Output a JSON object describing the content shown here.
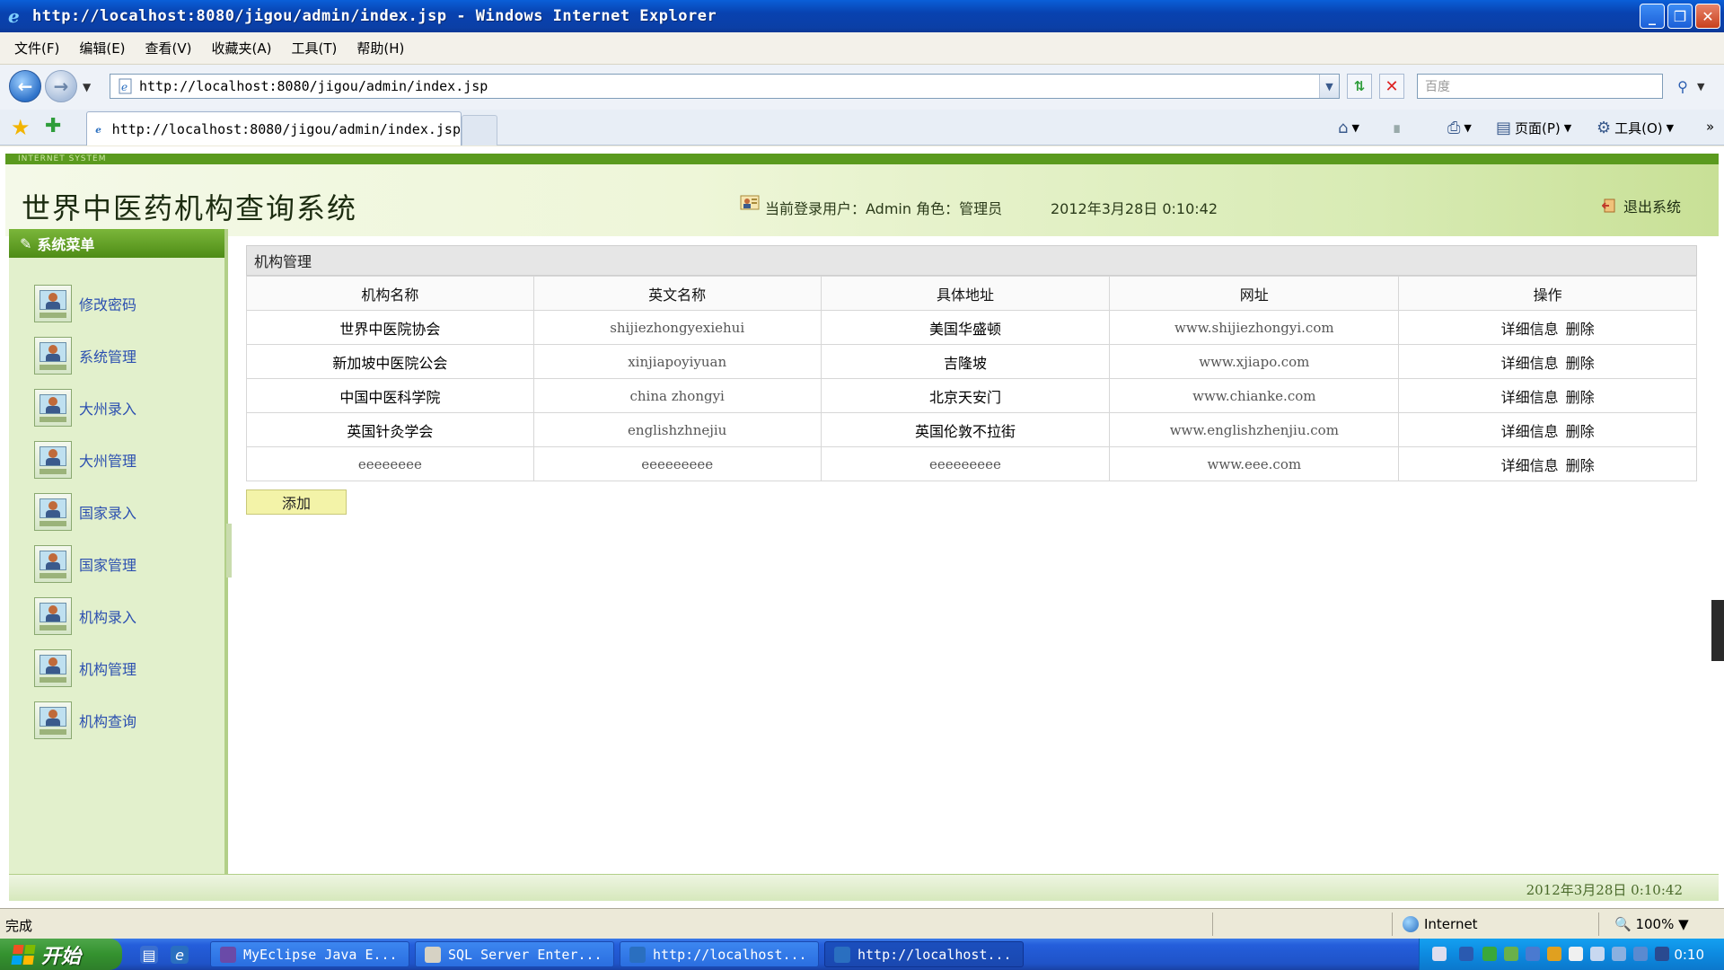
{
  "window": {
    "title": "http://localhost:8080/jigou/admin/index.jsp - Windows Internet Explorer",
    "buttons": {
      "minimize": "_",
      "restore": "❐",
      "close": "✕"
    }
  },
  "menubar": [
    "文件(F)",
    "编辑(E)",
    "查看(V)",
    "收藏夹(A)",
    "工具(T)",
    "帮助(H)"
  ],
  "address": {
    "url": "http://localhost:8080/jigou/admin/index.jsp",
    "search_placeholder": "百度"
  },
  "tab": {
    "label": "http://localhost:8080/jigou/admin/index.jsp"
  },
  "commandbar": {
    "page": "页面(P)",
    "tools": "工具(O)"
  },
  "header": {
    "en_strip": "INTERNET SYSTEM",
    "title": "世界中医药机构查询系统",
    "user_info": "当前登录用户：Admin 角色：管理员",
    "datetime": "2012年3月28日  0:10:42",
    "logout": "退出系统"
  },
  "sidebar": {
    "title": "系统菜单",
    "items": [
      {
        "label": "修改密码"
      },
      {
        "label": "系统管理"
      },
      {
        "label": "大州录入"
      },
      {
        "label": "大州管理"
      },
      {
        "label": "国家录入"
      },
      {
        "label": "国家管理"
      },
      {
        "label": "机构录入"
      },
      {
        "label": "机构管理"
      },
      {
        "label": "机构查询"
      }
    ]
  },
  "main": {
    "panel_title": "机构管理",
    "columns": [
      "机构名称",
      "英文名称",
      "具体地址",
      "网址",
      "操作"
    ],
    "rows": [
      {
        "name": "世界中医院协会",
        "en": "shijiezhongyexiehui",
        "addr": "美国华盛顿",
        "url": "www.shijiezhongyi.com"
      },
      {
        "name": "新加坡中医院公会",
        "en": "xinjiapoyiyuan",
        "addr": "吉隆坡",
        "url": "www.xjiapo.com"
      },
      {
        "name": "中国中医科学院",
        "en": "china zhongyi",
        "addr": "北京天安门",
        "url": "www.chianke.com"
      },
      {
        "name": "英国针灸学会",
        "en": "englishzhnejiu",
        "addr": "英国伦敦不拉街",
        "url": "www.englishzhenjiu.com"
      },
      {
        "name": "eeeeeeee",
        "en": "eeeeeeeee",
        "addr": "eeeeeeeee",
        "url": "www.eee.com"
      }
    ],
    "op_detail": "详细信息",
    "op_delete": "删除",
    "add_button": "添加"
  },
  "page_footer": {
    "timestamp": "2012年3月28日  0:10:42"
  },
  "statusbar": {
    "status": "完成",
    "zone": "Internet",
    "zoom": "100%"
  },
  "taskbar": {
    "start": "开始",
    "buttons": [
      {
        "label": "MyEclipse Java E..."
      },
      {
        "label": "SQL Server Enter..."
      },
      {
        "label": "http://localhost..."
      },
      {
        "label": "http://localhost..."
      }
    ],
    "clock": "0:10"
  },
  "colors": {
    "header_green": "#5a9a1e",
    "menu_link": "#2b4fb0",
    "add_button_bg": "#f3f3a8"
  }
}
